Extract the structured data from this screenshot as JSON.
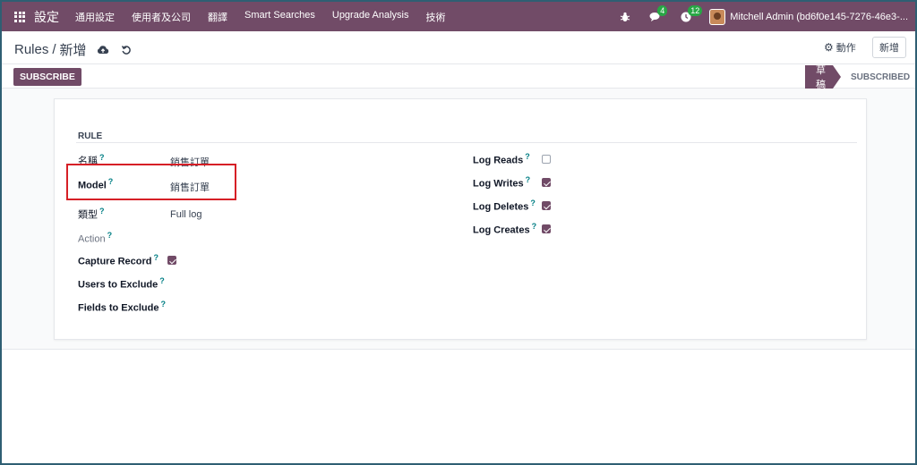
{
  "navbar": {
    "brand": "設定",
    "menu": [
      "通用設定",
      "使用者及公司",
      "翻譯",
      "Smart Searches",
      "Upgrade Analysis",
      "技術"
    ],
    "messages_count": "4",
    "activities_count": "12",
    "user": "Mitchell Admin (bd6f0e145-7276-46e3-..."
  },
  "control": {
    "breadcrumb_parent": "Rules",
    "breadcrumb_sep": "/",
    "breadcrumb_current": "新增",
    "action_label": "動作",
    "new_label": "新增",
    "subscribe_label": "SUBSCRIBE",
    "stage_active": "草稿",
    "stage_next": "SUBSCRIBED"
  },
  "form": {
    "group_title": "RULE",
    "help_mark": "?",
    "left": {
      "name_label": "名稱",
      "name_value": "銷售訂單",
      "model_label": "Model",
      "model_value": "銷售訂單",
      "type_label": "類型",
      "type_value": "Full log",
      "action_label": "Action",
      "capture_label": "Capture Record",
      "capture_checked": true,
      "users_label": "Users to Exclude",
      "fields_label": "Fields to Exclude"
    },
    "right": {
      "log_reads_label": "Log Reads",
      "log_reads_checked": false,
      "log_writes_label": "Log Writes",
      "log_writes_checked": true,
      "log_deletes_label": "Log Deletes",
      "log_deletes_checked": true,
      "log_creates_label": "Log Creates",
      "log_creates_checked": true
    }
  },
  "colors": {
    "brand": "#714b67",
    "help": "#017e84",
    "badge": "#28a745",
    "highlight": "#d61f26"
  }
}
